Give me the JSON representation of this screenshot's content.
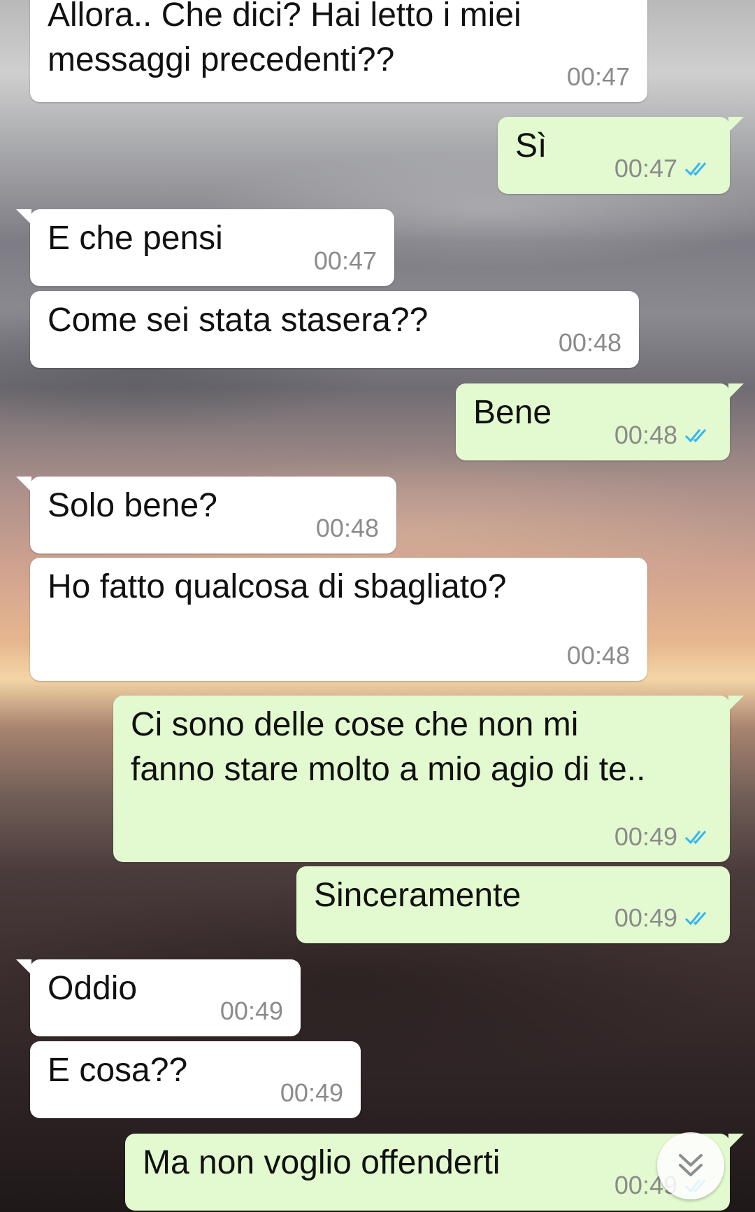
{
  "messages": [
    {
      "dir": "in",
      "text": "Allora.. Che dici? Hai letto i miei messaggi precedenti??",
      "time": "00:47",
      "tail": false
    },
    {
      "dir": "out",
      "text": "Sì",
      "time": "00:47",
      "tail": true
    },
    {
      "dir": "in",
      "text": "E che pensi",
      "time": "00:47",
      "tail": true
    },
    {
      "dir": "in",
      "text": "Come sei stata stasera??",
      "time": "00:48",
      "tail": false
    },
    {
      "dir": "out",
      "text": "Bene",
      "time": "00:48",
      "tail": true
    },
    {
      "dir": "in",
      "text": "Solo bene?",
      "time": "00:48",
      "tail": true
    },
    {
      "dir": "in",
      "text": "Ho fatto qualcosa di sbagliato?",
      "time": "00:48",
      "tail": false
    },
    {
      "dir": "out",
      "text": "Ci sono delle cose che non mi fanno stare molto a mio agio di te..",
      "time": "00:49",
      "tail": true
    },
    {
      "dir": "out",
      "text": "Sinceramente",
      "time": "00:49",
      "tail": false
    },
    {
      "dir": "in",
      "text": "Oddio",
      "time": "00:49",
      "tail": true
    },
    {
      "dir": "in",
      "text": "E cosa??",
      "time": "00:49",
      "tail": false
    },
    {
      "dir": "out",
      "text": "Ma non voglio offenderti",
      "time": "00:49",
      "tail": true
    }
  ],
  "colors": {
    "incoming_bubble": "#ffffff",
    "outgoing_bubble": "#e3f9cf",
    "read_ticks": "#34b7f1",
    "timestamp": "#8b8b8b"
  },
  "icons": {
    "read_status": "double-check-icon",
    "scroll_down": "double-chevron-down-icon"
  }
}
